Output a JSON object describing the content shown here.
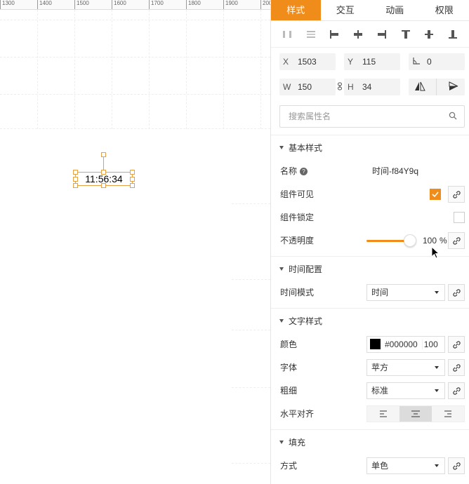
{
  "ruler": {
    "labels": [
      "1300",
      "1400",
      "1500",
      "1600",
      "1700",
      "1800",
      "1900",
      "200"
    ]
  },
  "widget": {
    "text": "11:56:34"
  },
  "tabs": [
    {
      "label": "样式"
    },
    {
      "label": "交互"
    },
    {
      "label": "动画"
    },
    {
      "label": "权限"
    }
  ],
  "active_tab": "样式",
  "geometry": {
    "x_label": "X",
    "x_value": "1503",
    "y_label": "Y",
    "y_value": "115",
    "angle_value": "0",
    "w_label": "W",
    "w_value": "150",
    "h_label": "H",
    "h_value": "34"
  },
  "search": {
    "placeholder": "搜索属性名"
  },
  "basic": {
    "title": "基本样式",
    "name_label": "名称",
    "name_value": "时间-f84Y9q",
    "visible_label": "组件可见",
    "visible_checked": true,
    "lock_label": "组件锁定",
    "lock_checked": false,
    "opacity_label": "不透明度",
    "opacity_value": "100",
    "opacity_unit": "%"
  },
  "time": {
    "title": "时间配置",
    "mode_label": "时间模式",
    "mode_value": "时间"
  },
  "text_style": {
    "title": "文字样式",
    "color_label": "颜色",
    "color_value": "#000000",
    "color_swatch": "#000000",
    "color_opacity": "100",
    "font_label": "字体",
    "font_value": "苹方",
    "weight_label": "粗细",
    "weight_value": "标准",
    "align_label": "水平对齐",
    "align_active": "center"
  },
  "fill": {
    "title": "填充",
    "mode_label": "方式",
    "mode_value": "单色"
  },
  "colors": {
    "accent": "#f08c1a",
    "widget_border": "#e8a046"
  }
}
